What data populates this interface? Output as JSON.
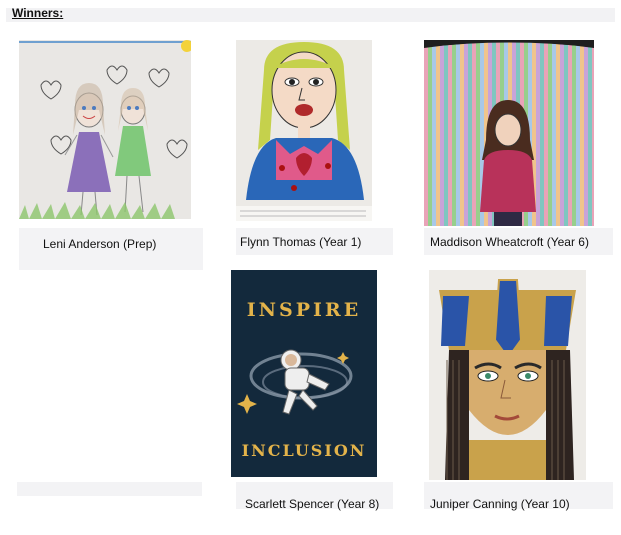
{
  "heading": "Winners:",
  "winners": [
    {
      "name": "Leni Anderson (Prep)"
    },
    {
      "name": "Flynn Thomas (Year 1)"
    },
    {
      "name": "Maddison Wheatcroft (Year 6)"
    },
    {
      "name": "Scarlett Spencer (Year 8)"
    },
    {
      "name": "Juniper Canning (Year 10)"
    }
  ],
  "poster": {
    "top_word": "INSPIRE",
    "bottom_word": "INCLUSION"
  }
}
